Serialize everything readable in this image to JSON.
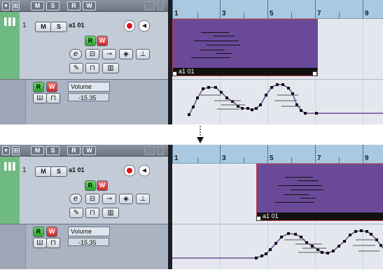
{
  "header": {
    "buttons": [
      "▾",
      "⊞",
      "M",
      "S",
      "R",
      "W"
    ],
    "right_icon": "grid-icon"
  },
  "track": {
    "number": "1",
    "name": "a1 01",
    "mute_label": "M",
    "solo_label": "S",
    "read_label": "R",
    "write_label": "W",
    "edit_label": "e"
  },
  "automation": {
    "read_label": "R",
    "write_label": "W",
    "parameter": "Volume",
    "value": "-15.35"
  },
  "ruler": {
    "bars": [
      "1",
      "3",
      "5",
      "7",
      "9"
    ]
  },
  "event": {
    "name": "a1 01"
  },
  "colors": {
    "event_fill": "#6a4a98",
    "event_border": "#c03845",
    "automation_line": "#6a4a98",
    "ruler": "#a9c9e2",
    "track_color": "#6fba82"
  }
}
